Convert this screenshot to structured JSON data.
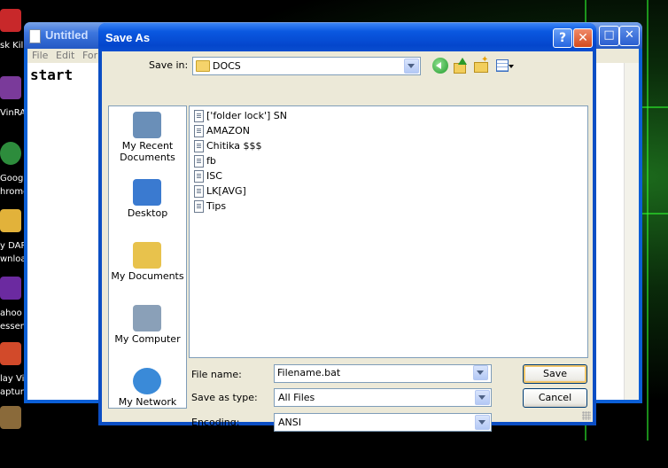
{
  "desktop": {
    "icons": [
      {
        "label": "sk Kill",
        "color": "#c8282a"
      },
      {
        "label": "VinRAI",
        "color": "#7a3a9a"
      },
      {
        "label": "Google\nhrome",
        "color": "#2d8c3c"
      },
      {
        "label": "y DAP\nwnloa",
        "color": "#e2b23a"
      },
      {
        "label": "ahoo\nessen",
        "color": "#6b2aa0"
      },
      {
        "label": "lay Vi\napture",
        "color": "#d24a2a"
      }
    ]
  },
  "notepad": {
    "title": "Untitled",
    "menu": [
      "File",
      "Edit",
      "For"
    ],
    "content": "start"
  },
  "dialog": {
    "title": "Save As",
    "help": "?",
    "close": "✕",
    "save_in_label": "Save in:",
    "save_in_value": "DOCS",
    "places": [
      {
        "label": "My Recent\nDocuments",
        "color": "#6a8fb8"
      },
      {
        "label": "Desktop",
        "color": "#3a7ad0"
      },
      {
        "label": "My Documents",
        "color": "#e8c24c"
      },
      {
        "label": "My Computer",
        "color": "#8aa0b8"
      },
      {
        "label": "My Network",
        "color": "#3a8ad8"
      }
    ],
    "files": [
      "['folder lock'] SN",
      "AMAZON",
      "Chitika $$$",
      "fb",
      "ISC",
      "LK[AVG]",
      "Tips"
    ],
    "file_name_label": "File name:",
    "file_name_value": "Filename.bat",
    "save_type_label": "Save as type:",
    "save_type_value": "All Files",
    "encoding_label": "Encoding:",
    "encoding_value": "ANSI",
    "save_button": "Save",
    "cancel_button": "Cancel"
  },
  "colors": {
    "title_bar": "#0a58e0",
    "dialog_face": "#ece9d8",
    "border": "#7f9db9"
  }
}
